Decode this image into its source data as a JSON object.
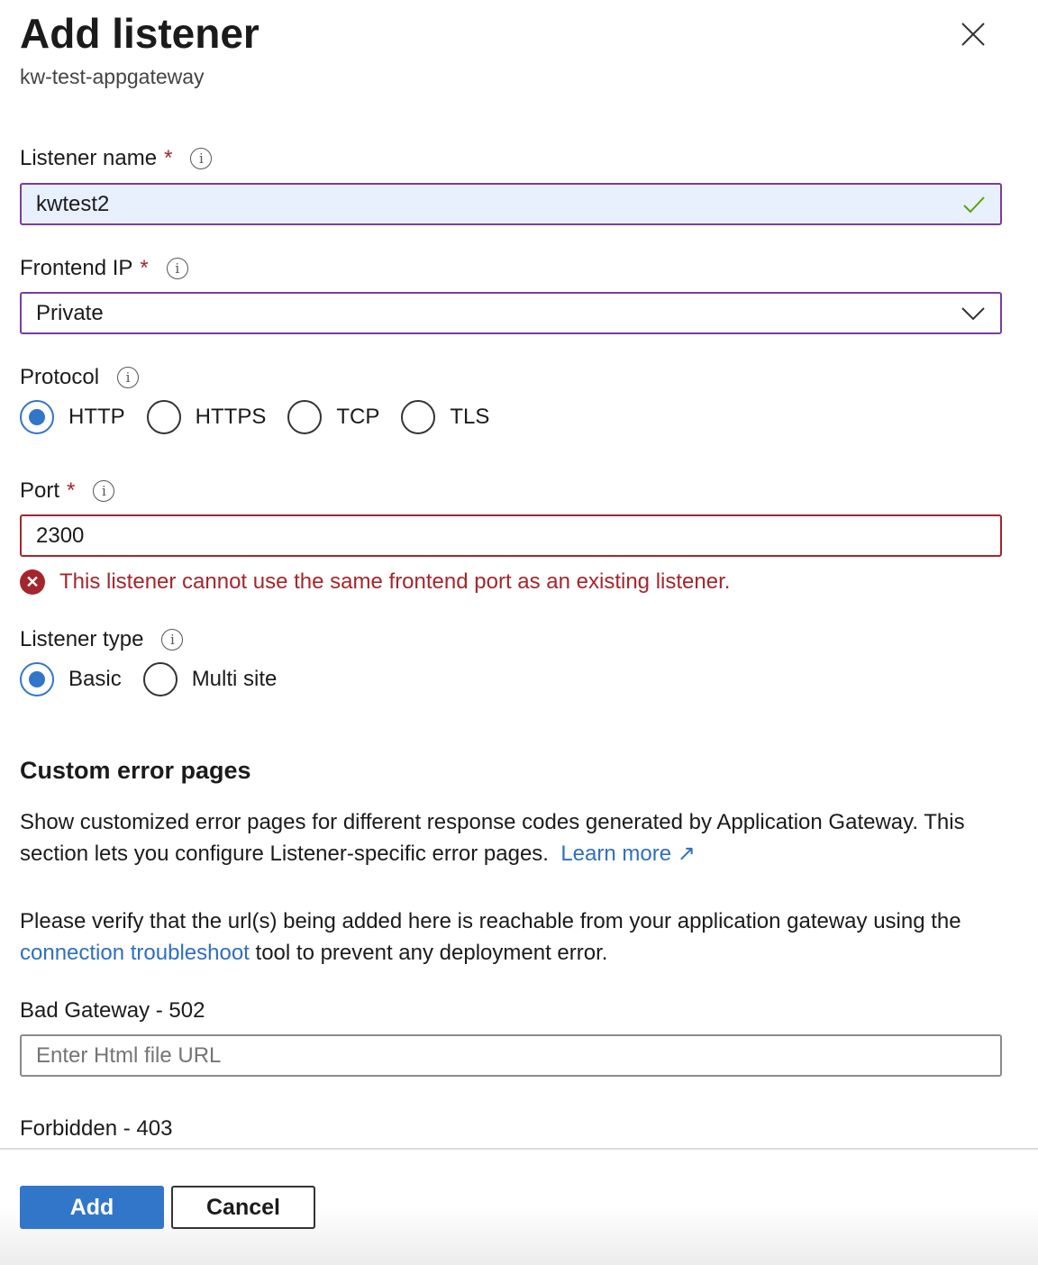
{
  "header": {
    "title": "Add listener",
    "subtitle": "kw-test-appgateway"
  },
  "listener_name": {
    "label": "Listener name",
    "required": "*",
    "value": "kwtest2"
  },
  "frontend_ip": {
    "label": "Frontend IP",
    "required": "*",
    "value": "Private"
  },
  "protocol": {
    "label": "Protocol",
    "options": [
      "HTTP",
      "HTTPS",
      "TCP",
      "TLS"
    ],
    "selected": "HTTP"
  },
  "port": {
    "label": "Port",
    "required": "*",
    "value": "2300",
    "error": "This listener cannot use the same frontend port as an existing listener."
  },
  "listener_type": {
    "label": "Listener type",
    "options": [
      "Basic",
      "Multi site"
    ],
    "selected": "Basic"
  },
  "custom_error": {
    "heading": "Custom error pages",
    "para1": "Show customized error pages for different response codes generated by Application Gateway. This section lets you configure Listener-specific error pages.",
    "learn_more": "Learn more",
    "para2_a": "Please verify that the url(s) being added here is reachable from your application gateway using the",
    "para2_link": "connection troubleshoot",
    "para2_b": "tool to prevent any deployment error.",
    "bad_gateway_label": "Bad Gateway - 502",
    "url_placeholder": "Enter Html file URL",
    "forbidden_label": "Forbidden - 403"
  },
  "footer": {
    "add": "Add",
    "cancel": "Cancel"
  },
  "colors": {
    "accent": "#3276c9",
    "error": "#a4262c",
    "focus_border": "#7a3ca0"
  }
}
